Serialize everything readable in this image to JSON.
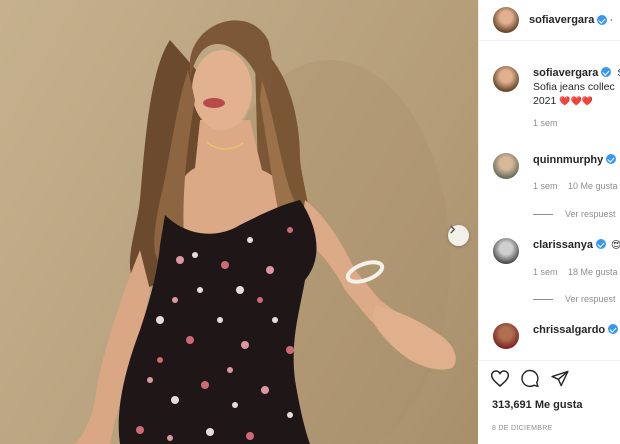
{
  "post": {
    "author": "sofiavergara",
    "caption_author": "sofiavergara",
    "caption_line1_suffix": "Sl",
    "caption_line2": "Sofia jeans collec",
    "caption_line3": "2021",
    "caption_hearts": "❤️❤️❤️",
    "caption_time": "1 sem"
  },
  "comments": [
    {
      "user": "quinnmurphy",
      "time": "1 sem",
      "likes": "10 Me gusta",
      "view_replies": "Ver respuest"
    },
    {
      "user": "clarissanya",
      "time": "1 sem",
      "likes": "18 Me gusta",
      "view_replies": "Ver respuest",
      "emoji": "😍"
    },
    {
      "user": "chrissalgardo",
      "time": "",
      "likes": ""
    }
  ],
  "footer": {
    "likes": "313,691 Me gusta",
    "date": "8 DE DICIEMBRE"
  },
  "colors": {
    "verified": "#3897f0",
    "text": "#262626",
    "muted": "#8e8e8e",
    "heart": "#ed4956"
  },
  "icons": [
    "heart-icon",
    "comment-icon",
    "share-icon",
    "chevron-right-icon",
    "verified-icon"
  ]
}
